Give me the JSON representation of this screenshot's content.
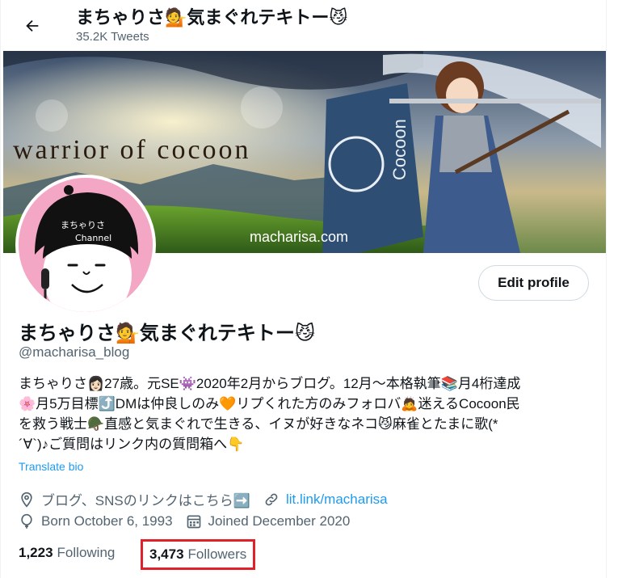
{
  "header": {
    "title": "まちゃりさ💁気まぐれテキトー😼",
    "tweets": "35.2K Tweets"
  },
  "banner": {
    "headline": "warrior of cocoon",
    "flag_text": "Cocoon",
    "url": "macharisa.com"
  },
  "avatar": {
    "text_line1": "まちゃりさ",
    "text_line2": "Channel"
  },
  "profile": {
    "edit_label": "Edit profile",
    "name": "まちゃりさ💁気まぐれテキトー😼",
    "handle": "@macharisa_blog",
    "bio": [
      "まちゃりさ👩🏻27歳。元SE👾2020年2月からブログ。12月～本格執筆📚月4桁達成",
      "🌸月5万目標⤴️DMは仲良しのみ🧡リプくれた方のみフォロバ🙇迷えるCocoon民",
      "を救う戦士🪖直感と気まぐれで生きる、イヌが好きなネコ😼麻雀とたまに歌(*",
      "´∀`)♪ご質問はリンク内の質問箱へ👇"
    ],
    "translate_label": "Translate bio",
    "location": "ブログ、SNSのリンクはこちら➡️",
    "website": "lit.link/macharisa",
    "birthday": "Born October 6, 1993",
    "joined": "Joined December 2020"
  },
  "stats": {
    "following_count": "1,223",
    "following_label": "Following",
    "followers_count": "3,473",
    "followers_label": "Followers"
  },
  "colors": {
    "link": "#1d9bf0",
    "highlight_box": "#e0212b",
    "secondary_text": "#536471"
  },
  "icons": {
    "back": "arrow-left-icon",
    "location": "location-pin-icon",
    "link": "link-icon",
    "birthday": "balloon-icon",
    "joined": "calendar-icon"
  }
}
